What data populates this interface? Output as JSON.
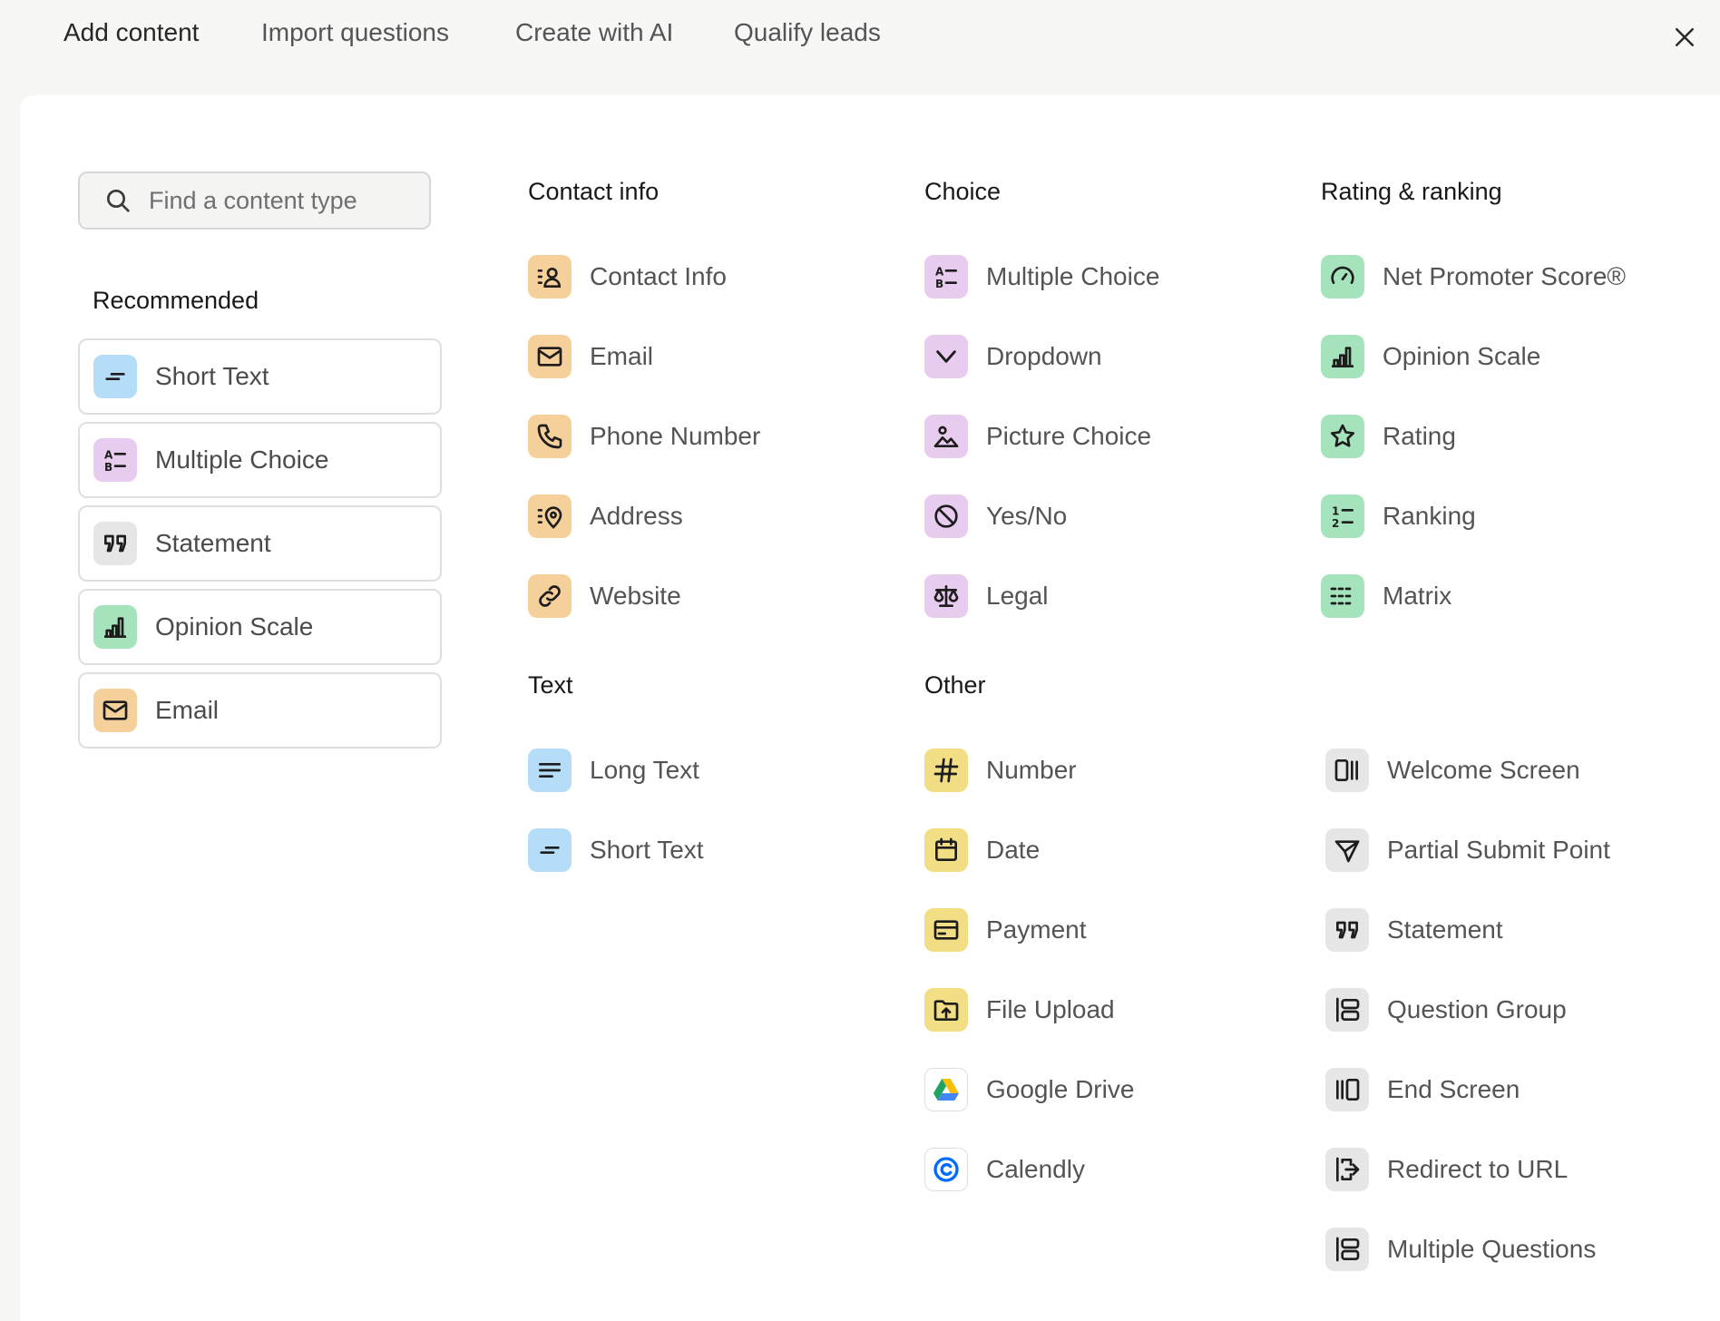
{
  "tabs": [
    {
      "label": "Add content"
    },
    {
      "label": "Import questions"
    },
    {
      "label": "Create with AI"
    },
    {
      "label": "Qualify leads"
    }
  ],
  "search": {
    "placeholder": "Find a content type"
  },
  "recommended": {
    "title": "Recommended",
    "items": [
      {
        "label": "Short Text",
        "icon": "short-text-icon"
      },
      {
        "label": "Multiple Choice",
        "icon": "multiple-choice-icon"
      },
      {
        "label": "Statement",
        "icon": "quote-icon"
      },
      {
        "label": "Opinion Scale",
        "icon": "bar-chart-icon"
      },
      {
        "label": "Email",
        "icon": "envelope-icon"
      }
    ]
  },
  "contact_info": {
    "title": "Contact info",
    "items": [
      {
        "label": "Contact Info",
        "icon": "contact-card-icon"
      },
      {
        "label": "Email",
        "icon": "envelope-icon"
      },
      {
        "label": "Phone Number",
        "icon": "phone-icon"
      },
      {
        "label": "Address",
        "icon": "location-pin-icon"
      },
      {
        "label": "Website",
        "icon": "link-icon"
      }
    ]
  },
  "text": {
    "title": "Text",
    "items": [
      {
        "label": "Long Text",
        "icon": "long-text-icon"
      },
      {
        "label": "Short Text",
        "icon": "short-text-icon"
      }
    ]
  },
  "choice": {
    "title": "Choice",
    "items": [
      {
        "label": "Multiple Choice",
        "icon": "multiple-choice-icon"
      },
      {
        "label": "Dropdown",
        "icon": "chevron-down-icon"
      },
      {
        "label": "Picture Choice",
        "icon": "picture-icon"
      },
      {
        "label": "Yes/No",
        "icon": "yes-no-icon"
      },
      {
        "label": "Legal",
        "icon": "scales-icon"
      }
    ]
  },
  "other": {
    "title": "Other",
    "items": [
      {
        "label": "Number",
        "icon": "hash-icon"
      },
      {
        "label": "Date",
        "icon": "calendar-icon"
      },
      {
        "label": "Payment",
        "icon": "credit-card-icon"
      },
      {
        "label": "File Upload",
        "icon": "folder-upload-icon"
      },
      {
        "label": "Google Drive",
        "icon": "google-drive-icon"
      },
      {
        "label": "Calendly",
        "icon": "calendly-icon"
      }
    ]
  },
  "rating_ranking": {
    "title": "Rating & ranking",
    "items": [
      {
        "label": "Net Promoter Score®",
        "icon": "gauge-icon"
      },
      {
        "label": "Opinion Scale",
        "icon": "bar-chart-icon"
      },
      {
        "label": "Rating",
        "icon": "star-icon"
      },
      {
        "label": "Ranking",
        "icon": "ranking-icon"
      },
      {
        "label": "Matrix",
        "icon": "matrix-icon"
      }
    ]
  },
  "screens": {
    "items": [
      {
        "label": "Welcome Screen",
        "icon": "welcome-screen-icon"
      },
      {
        "label": "Partial Submit Point",
        "icon": "send-icon"
      },
      {
        "label": "Statement",
        "icon": "quote-icon"
      },
      {
        "label": "Question Group",
        "icon": "question-group-icon"
      },
      {
        "label": "End Screen",
        "icon": "end-screen-icon"
      },
      {
        "label": "Redirect to URL",
        "icon": "redirect-icon"
      },
      {
        "label": "Multiple Questions",
        "icon": "multiple-questions-icon"
      }
    ]
  },
  "colors": {
    "contact": "#f6d09a",
    "choice": "#e7ccf0",
    "rating": "#a5e3bd",
    "text": "#b6ddf8",
    "other": "#f2de84",
    "screens": "#e6e6e6"
  }
}
